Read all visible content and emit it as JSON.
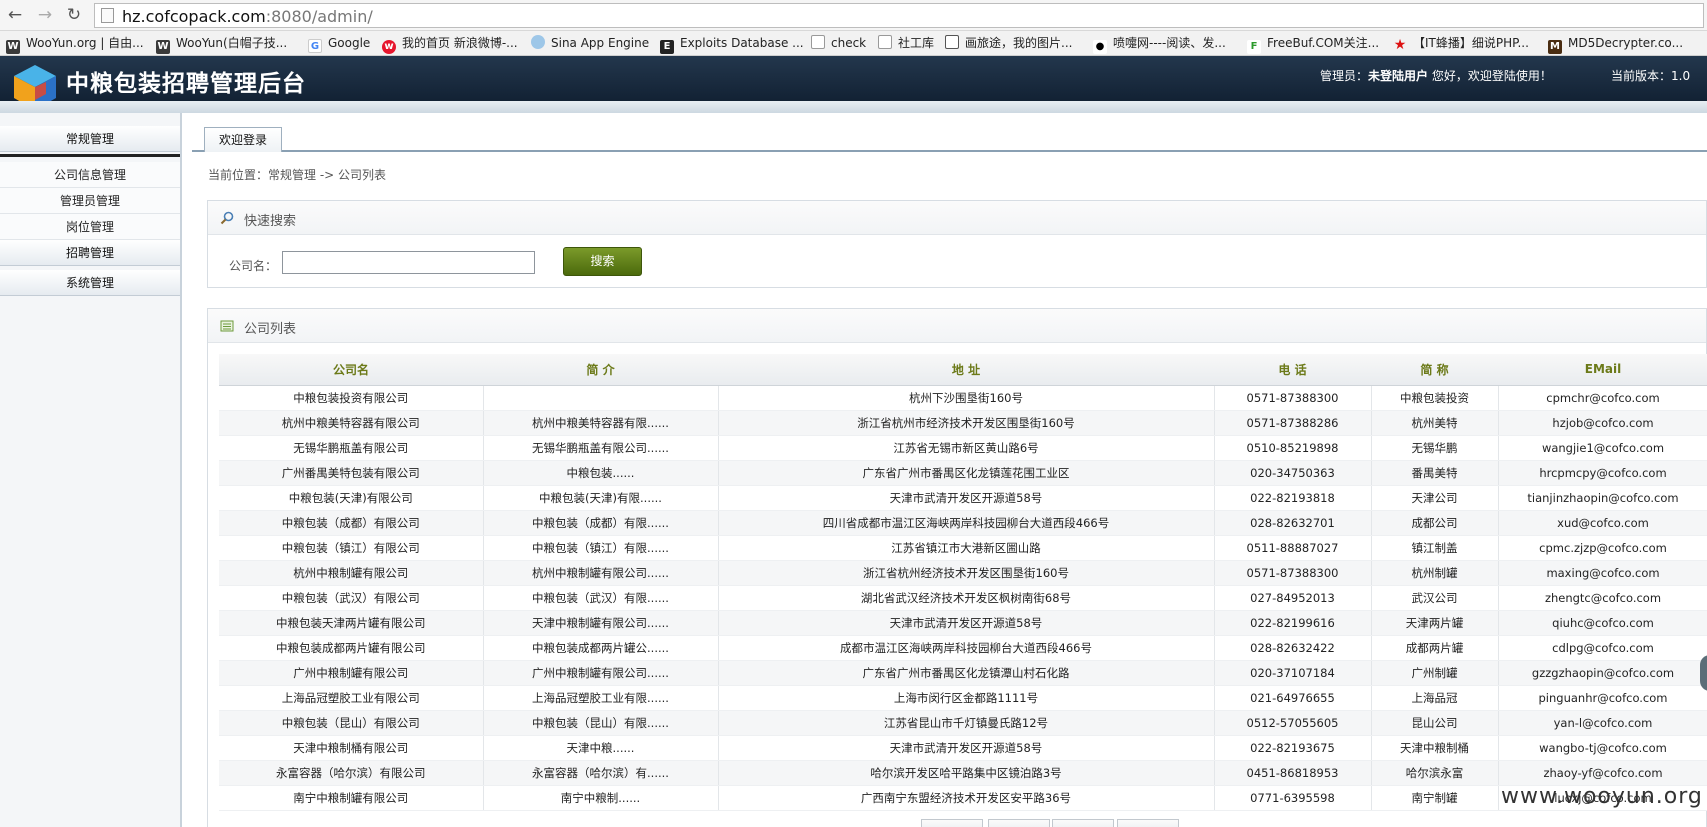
{
  "browser": {
    "url_host": "hz.cofcopack.com",
    "url_rest": ":8080/admin/",
    "bookmarks": [
      {
        "label": "WooYun.org | 自由...",
        "icon": "wooyun-icon"
      },
      {
        "label": "WooYun(白帽子技...",
        "icon": "wooyun-icon"
      },
      {
        "label": "Google",
        "icon": "google-icon"
      },
      {
        "label": "我的首页 新浪微博-...",
        "icon": "weibo-icon"
      },
      {
        "label": "Sina App Engine",
        "icon": "cloud-icon"
      },
      {
        "label": "Exploits Database ...",
        "icon": "exploit-db-icon"
      },
      {
        "label": "check",
        "icon": "page-icon"
      },
      {
        "label": "社工库",
        "icon": "page-icon"
      },
      {
        "label": "画旅途，我的图片...",
        "icon": "gallery-icon"
      },
      {
        "label": "喷嚏网----阅读、发...",
        "icon": "pentie-icon"
      },
      {
        "label": "FreeBuf.COM关注...",
        "icon": "freebuf-icon"
      },
      {
        "label": "【IT蜂播】细说PHP...",
        "icon": "star-icon"
      },
      {
        "label": "MD5Decrypter.co...",
        "icon": "md5-icon"
      }
    ]
  },
  "header": {
    "title": "中粮包装招聘管理后台",
    "admin_prefix": "管理员：",
    "admin_user": "未登陆用户",
    "admin_greeting": " 您好，欢迎登陆使用！",
    "version": "当前版本：1.0"
  },
  "sidebar": {
    "sections": {
      "general": "常规管理",
      "recruit": "招聘管理",
      "system": "系统管理"
    },
    "items": [
      "公司信息管理",
      "管理员管理",
      "岗位管理"
    ]
  },
  "main": {
    "tab_label": "欢迎登录",
    "breadcrumb": "当前位置：常规管理 -> 公司列表",
    "search": {
      "title": "快速搜索",
      "label": "公司名：",
      "value": "",
      "button": "搜索"
    },
    "list": {
      "title": "公司列表",
      "columns": [
        "公司名",
        "简 介",
        "地 址",
        "电 话",
        "简 称",
        "EMail"
      ],
      "rows": [
        [
          "中粮包装投资有限公司",
          "",
          "杭州下沙围垦街160号",
          "0571-87388300",
          "中粮包装投资",
          "cpmchr@cofco.com"
        ],
        [
          "杭州中粮美特容器有限公司",
          "杭州中粮美特容器有限......",
          "浙江省杭州市经济技术开发区围垦街160号",
          "0571-87388286",
          "杭州美特",
          "hzjob@cofco.com"
        ],
        [
          "无锡华鹏瓶盖有限公司",
          "无锡华鹏瓶盖有限公司......",
          "江苏省无锡市新区黄山路6号",
          "0510-85219898",
          "无锡华鹏",
          "wangjie1@cofco.com"
        ],
        [
          "广州番禺美特包装有限公司",
          "中粮包装......",
          "广东省广州市番禺区化龙镇莲花围工业区",
          "020-34750363",
          "番禺美特",
          "hrcpmcpy@cofco.com"
        ],
        [
          "中粮包装(天津)有限公司",
          "中粮包装(天津)有限......",
          "天津市武清开发区开源道58号",
          "022-82193818",
          "天津公司",
          "tianjinzhaopin@cofco.com"
        ],
        [
          "中粮包装（成都）有限公司",
          "中粮包装（成都）有限......",
          "四川省成都市温江区海峡两岸科技园柳台大道西段466号",
          "028-82632701",
          "成都公司",
          "xud@cofco.com"
        ],
        [
          "中粮包装（镇江）有限公司",
          "中粮包装（镇江）有限......",
          "江苏省镇江市大港新区圌山路",
          "0511-88887027",
          "镇江制盖",
          "cpmc.zjzp@cofco.com"
        ],
        [
          "杭州中粮制罐有限公司",
          "杭州中粮制罐有限公司......",
          "浙江省杭州经济技术开发区围垦街160号",
          "0571-87388300",
          "杭州制罐",
          "maxing@cofco.com"
        ],
        [
          "中粮包装（武汉）有限公司",
          "中粮包装（武汉）有限......",
          "湖北省武汉经济技术开发区枫树南街68号",
          "027-84952013",
          "武汉公司",
          "zhengtc@cofco.com"
        ],
        [
          "中粮包装天津两片罐有限公司",
          "天津中粮制罐有限公司......",
          "天津市武清开发区开源道58号",
          "022-82199616",
          "天津两片罐",
          "qiuhc@cofco.com"
        ],
        [
          "中粮包装成都两片罐有限公司",
          "中粮包装成都两片罐公......",
          "成都市温江区海峡两岸科技园柳台大道西段466号",
          "028-82632422",
          "成都两片罐",
          "cdlpg@cofco.com"
        ],
        [
          "广州中粮制罐有限公司",
          "广州中粮制罐有限公司......",
          "广东省广州市番禺区化龙镇潭山村石化路",
          "020-37107184",
          "广州制罐",
          "gzzgzhaopin@cofco.com"
        ],
        [
          "上海品冠塑胶工业有限公司",
          "上海品冠塑胶工业有限......",
          "上海市闵行区金都路1111号",
          "021-64976655",
          "上海品冠",
          "pinguanhr@cofco.com"
        ],
        [
          "中粮包装（昆山）有限公司",
          "中粮包装（昆山）有限......",
          "江苏省昆山市千灯镇曼氏路12号",
          "0512-57055605",
          "昆山公司",
          "yan-l@cofco.com"
        ],
        [
          "天津中粮制桶有限公司",
          "天津中粮......",
          "天津市武清开发区开源道58号",
          "022-82193675",
          "天津中粮制桶",
          "wangbo-tj@cofco.com"
        ],
        [
          "永富容器（哈尔滨）有限公司",
          "永富容器（哈尔滨）有......",
          "哈尔滨开发区哈平路集中区镜泊路3号",
          "0451-86818953",
          "哈尔滨永富",
          "zhaoy-yf@cofco.com"
        ],
        [
          "南宁中粮制罐有限公司",
          "南宁中粮制......",
          "广西南宁东盟经济技术开发区安平路36号",
          "0771-6395598",
          "南宁制罐",
          "luoxj@cofco.com"
        ]
      ]
    }
  },
  "watermark": "www.wooyun.org",
  "colors": {
    "header_bg": "#1a2b3e",
    "column_header_text": "#6c7a19",
    "search_button": "#5f7e1a"
  }
}
